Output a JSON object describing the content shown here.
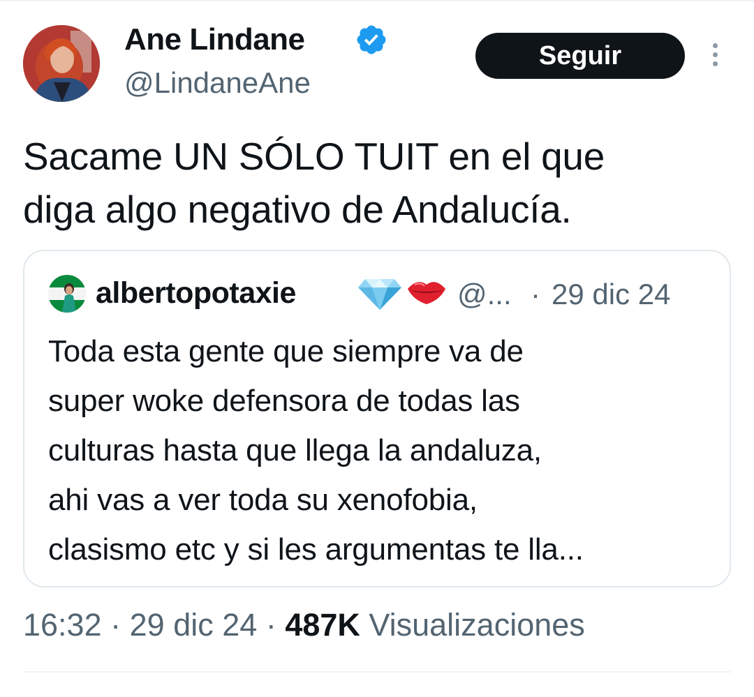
{
  "tweet": {
    "author_name": "Ane Lindane",
    "handle": "@LindaneAne",
    "verified": true,
    "follow_label": "Seguir",
    "text_line1": "Sacame UN SÓLO TUIT en el que",
    "text_line2": "diga algo negativo de Andalucía."
  },
  "quote": {
    "author_name": "albertopotaxie",
    "emojis": [
      "gem-icon",
      "lips-icon"
    ],
    "handle": "@...",
    "separator": "·",
    "date": "29 dic 24",
    "lines": [
      "Toda esta gente que siempre va de",
      "super woke defensora de todas las",
      "culturas hasta que llega la andaluza,",
      "ahi vas a ver toda su xenofobia,",
      "clasismo etc y si les argumentas te lla..."
    ]
  },
  "meta": {
    "time": "16:32",
    "sep1": "·",
    "date": "29 dic 24",
    "sep2": "·",
    "views_count": "487K",
    "views_label": "Visualizaciones"
  },
  "colors": {
    "text": "#0f1419",
    "secondary": "#536471",
    "verified_blue": "#1d9bf0",
    "button_bg": "#0f1419",
    "border": "#e1e8ed"
  }
}
